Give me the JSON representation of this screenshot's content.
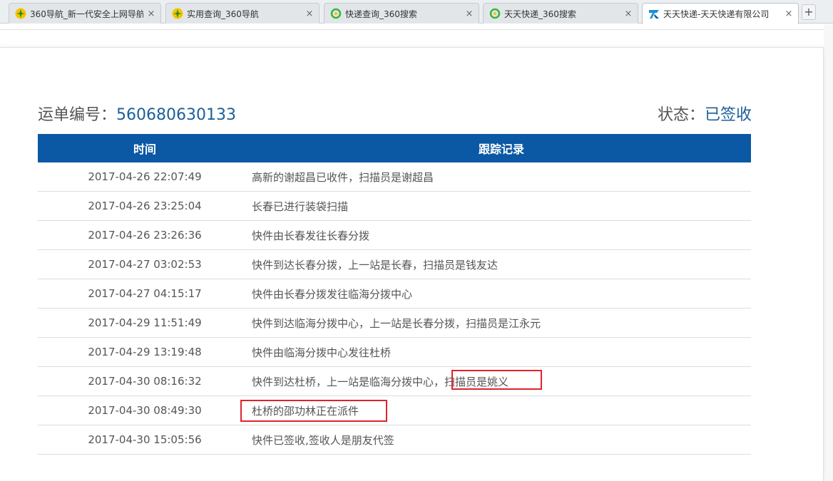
{
  "tabs": [
    {
      "title": "360导航_新一代安全上网导航",
      "icon": "360-nav-icon"
    },
    {
      "title": "实用查询_360导航",
      "icon": "360-nav-icon"
    },
    {
      "title": "快递查询_360搜索",
      "icon": "360-search-icon"
    },
    {
      "title": "天天快递_360搜索",
      "icon": "360-search-icon"
    },
    {
      "title": "天天快递-天天快递有限公司",
      "icon": "ttk-logo-icon",
      "active": true
    }
  ],
  "newtab_label": "+",
  "close_glyph": "×",
  "header": {
    "waybill_label": "运单编号：",
    "waybill_number": "560680630133",
    "status_label": "状态：",
    "status_value": "已签收"
  },
  "table": {
    "columns": [
      "时间",
      "跟踪记录"
    ],
    "rows": [
      {
        "time": "2017-04-26 22:07:49",
        "record": "高新的谢超昌已收件，扫描员是谢超昌"
      },
      {
        "time": "2017-04-26 23:25:04",
        "record": "长春已进行装袋扫描"
      },
      {
        "time": "2017-04-26 23:26:36",
        "record": "快件由长春发往长春分拨"
      },
      {
        "time": "2017-04-27 03:02:53",
        "record": "快件到达长春分拨，上一站是长春，扫描员是钱友达"
      },
      {
        "time": "2017-04-27 04:15:17",
        "record": "快件由长春分拨发往临海分拨中心"
      },
      {
        "time": "2017-04-29 11:51:49",
        "record": "快件到达临海分拨中心，上一站是长春分拨，扫描员是江永元"
      },
      {
        "time": "2017-04-29 13:19:48",
        "record": "快件由临海分拨中心发往杜桥"
      },
      {
        "time": "2017-04-30 08:16:32",
        "record": "快件到达杜桥，上一站是临海分拨中心，扫描员是姚义"
      },
      {
        "time": "2017-04-30 08:49:30",
        "record": "杜桥的邵功林正在派件"
      },
      {
        "time": "2017-04-30 15:05:56",
        "record": "快件已签收,签收人是朋友代签"
      }
    ]
  },
  "colors": {
    "header_blue": "#0b58a5",
    "link_blue": "#1b5f99",
    "highlight_red": "#e0232b"
  }
}
